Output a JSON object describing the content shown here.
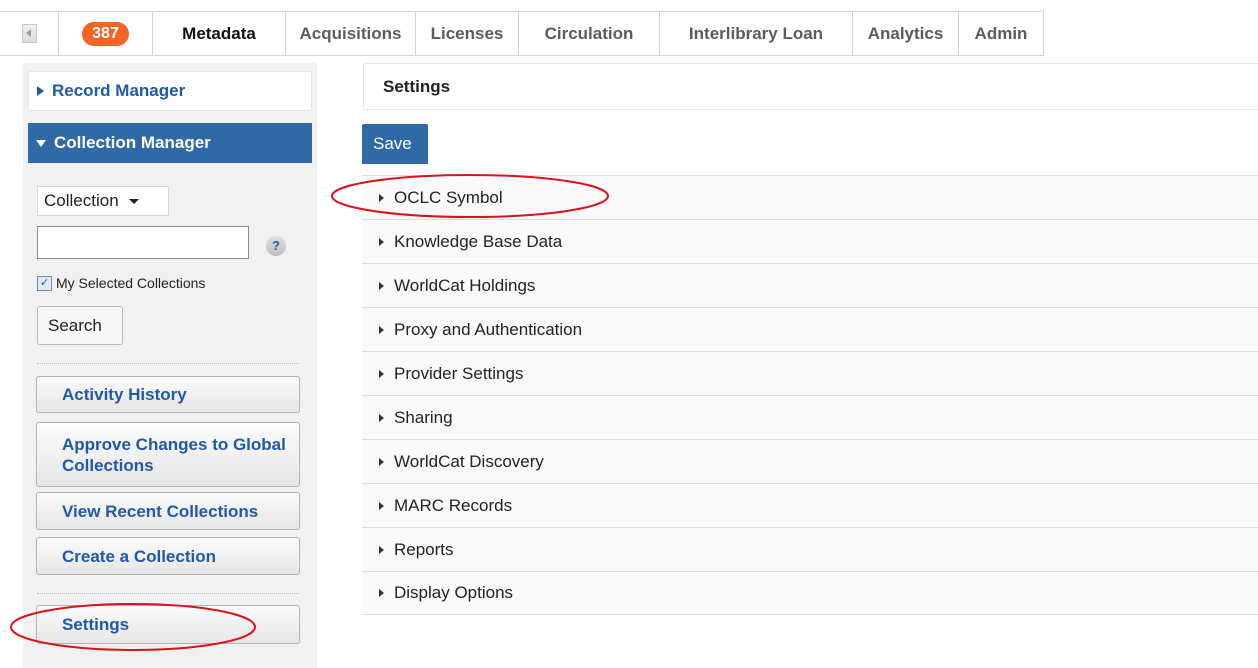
{
  "topnav": {
    "badge_count": "387",
    "tabs": [
      {
        "label": "Metadata"
      },
      {
        "label": "Acquisitions"
      },
      {
        "label": "Licenses"
      },
      {
        "label": "Circulation"
      },
      {
        "label": "Interlibrary Loan"
      },
      {
        "label": "Analytics"
      },
      {
        "label": "Admin"
      }
    ]
  },
  "sidebar": {
    "record_manager": "Record Manager",
    "collection_manager": "Collection Manager",
    "collection_select": "Collection",
    "search_input_value": "",
    "help_glyph": "?",
    "my_selected_label": "My Selected Collections",
    "search_button": "Search",
    "buttons": [
      {
        "label": "Activity History"
      },
      {
        "label": "Approve Changes to Global Collections"
      },
      {
        "label": "View Recent Collections"
      },
      {
        "label": "Create a Collection"
      },
      {
        "label": "Settings"
      }
    ]
  },
  "main": {
    "title": "Settings",
    "save_button": "Save",
    "sections": [
      {
        "label": "OCLC Symbol"
      },
      {
        "label": "Knowledge Base Data"
      },
      {
        "label": "WorldCat Holdings"
      },
      {
        "label": "Proxy and Authentication"
      },
      {
        "label": "Provider Settings"
      },
      {
        "label": "Sharing"
      },
      {
        "label": "WorldCat Discovery"
      },
      {
        "label": "MARC Records"
      },
      {
        "label": "Reports"
      },
      {
        "label": "Display Options"
      }
    ]
  },
  "colors": {
    "accent_blue": "#2f6aa6",
    "link_blue": "#1f5aa6",
    "badge_orange": "#f26522",
    "annotation_red": "#d9141c"
  },
  "icons": [
    "collapse-left-icon",
    "help-icon",
    "checkbox-checked-icon",
    "caret-down-icon",
    "triangle-right-icon",
    "triangle-down-icon"
  ]
}
